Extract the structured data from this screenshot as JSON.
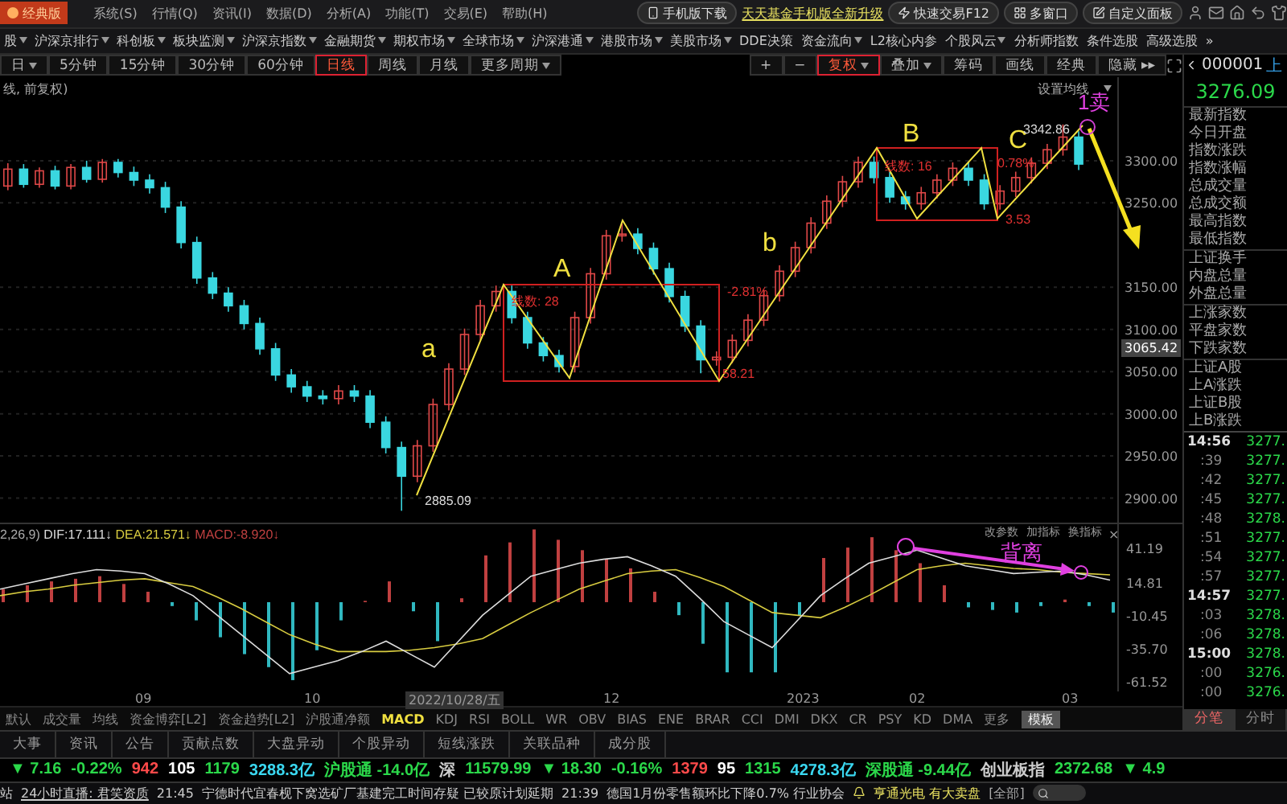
{
  "title_bar": {
    "logo": "经典版",
    "menus": [
      "系统(S)",
      "行情(Q)",
      "资讯(I)",
      "数据(D)",
      "分析(A)",
      "功能(T)",
      "交易(E)",
      "帮助(H)"
    ],
    "download": "手机版下载",
    "promo": "天天基金手机版全新升级",
    "buttons": [
      "快速交易F12",
      "多窗口",
      "自定义面板"
    ]
  },
  "nav": {
    "items": [
      {
        "label": "股",
        "dropdown": true
      },
      {
        "label": "沪深京排行",
        "dropdown": true
      },
      {
        "label": "科创板",
        "dropdown": true
      },
      {
        "label": "板块监测",
        "dropdown": true
      },
      {
        "label": "沪深京指数",
        "dropdown": true
      },
      {
        "label": "金融期货",
        "dropdown": true
      },
      {
        "label": "期权市场",
        "dropdown": true
      },
      {
        "label": "全球市场",
        "dropdown": true
      },
      {
        "label": "沪深港通",
        "dropdown": true
      },
      {
        "label": "港股市场",
        "dropdown": true
      },
      {
        "label": "美股市场",
        "dropdown": true
      },
      {
        "label": "DDE决策",
        "dropdown": false
      },
      {
        "label": "资金流向",
        "dropdown": true
      },
      {
        "label": "L2核心内参",
        "dropdown": false
      },
      {
        "label": "个股风云",
        "dropdown": true
      },
      {
        "label": "分析师指数",
        "dropdown": false
      },
      {
        "label": "条件选股",
        "dropdown": false
      },
      {
        "label": "高级选股",
        "dropdown": false
      }
    ],
    "more": "»"
  },
  "period_bar": {
    "periods": [
      {
        "label": "日",
        "dropdown": true,
        "selected": false
      },
      {
        "label": "5分钟",
        "dropdown": false,
        "selected": false
      },
      {
        "label": "15分钟",
        "dropdown": false,
        "selected": false
      },
      {
        "label": "30分钟",
        "dropdown": false,
        "selected": false
      },
      {
        "label": "60分钟",
        "dropdown": false,
        "selected": false
      },
      {
        "label": "日线",
        "dropdown": false,
        "selected": true
      },
      {
        "label": "周线",
        "dropdown": false,
        "selected": false
      },
      {
        "label": "月线",
        "dropdown": false,
        "selected": false
      },
      {
        "label": "更多周期",
        "dropdown": true,
        "selected": false
      }
    ],
    "tools": [
      {
        "label": "+",
        "dropdown": false,
        "selected": false
      },
      {
        "label": "−",
        "dropdown": false,
        "selected": false
      },
      {
        "label": "复权",
        "dropdown": true,
        "selected": true
      },
      {
        "label": "叠加",
        "dropdown": true,
        "selected": false
      },
      {
        "label": "筹码",
        "dropdown": false,
        "selected": false
      },
      {
        "label": "画线",
        "dropdown": false,
        "selected": false
      },
      {
        "label": "经典",
        "dropdown": false,
        "selected": false
      },
      {
        "label": "隐藏 ▸▸",
        "dropdown": false,
        "selected": false
      }
    ]
  },
  "chart": {
    "caption": "线, 前复权)",
    "ma_setting": "设置均线",
    "current_price": "3065.42",
    "annotations": [
      {
        "kind": "wave",
        "text": "a"
      },
      {
        "kind": "wave",
        "text": "A"
      },
      {
        "kind": "wave",
        "text": "b"
      },
      {
        "kind": "wave",
        "text": "B"
      },
      {
        "kind": "wave",
        "text": "C"
      },
      {
        "kind": "signal",
        "text": "1卖"
      },
      {
        "kind": "price",
        "text": "2885.09"
      },
      {
        "kind": "price",
        "text": "3342.86"
      },
      {
        "kind": "range",
        "text": "-2.81%"
      },
      {
        "kind": "range",
        "text": "0.78%"
      },
      {
        "kind": "range",
        "text": "58.21"
      },
      {
        "kind": "range",
        "text": "3.53"
      },
      {
        "kind": "range",
        "text": "线数: 28"
      },
      {
        "kind": "range",
        "text": "线数: 16"
      }
    ],
    "chart_data": {
      "type": "candlestick",
      "ylim": [
        2871,
        3399
      ],
      "yticks": [
        {
          "value": 3300,
          "label": "3300.00"
        },
        {
          "value": 3250,
          "label": "3250.00"
        },
        {
          "value": 3150,
          "label": "3150.00"
        },
        {
          "value": 3100,
          "label": "3100.00"
        },
        {
          "value": 3050,
          "label": "3050.00"
        },
        {
          "value": 3000,
          "label": "3000.00"
        },
        {
          "value": 2950,
          "label": "2950.00"
        },
        {
          "value": 2900,
          "label": "2900.00"
        }
      ],
      "grid": true,
      "ohlc": [
        [
          3270,
          3297,
          3265,
          3290
        ],
        [
          3290,
          3296,
          3268,
          3272
        ],
        [
          3272,
          3292,
          3268,
          3288
        ],
        [
          3288,
          3294,
          3266,
          3270
        ],
        [
          3270,
          3296,
          3266,
          3292
        ],
        [
          3292,
          3300,
          3274,
          3278
        ],
        [
          3278,
          3302,
          3274,
          3298
        ],
        [
          3298,
          3302,
          3280,
          3286
        ],
        [
          3286,
          3293,
          3270,
          3277
        ],
        [
          3277,
          3284,
          3261,
          3268
        ],
        [
          3268,
          3275,
          3238,
          3245
        ],
        [
          3245,
          3252,
          3196,
          3203
        ],
        [
          3203,
          3210,
          3154,
          3161
        ],
        [
          3161,
          3168,
          3136,
          3143
        ],
        [
          3143,
          3150,
          3121,
          3128
        ],
        [
          3128,
          3135,
          3100,
          3107
        ],
        [
          3107,
          3114,
          3070,
          3077
        ],
        [
          3077,
          3084,
          3039,
          3046
        ],
        [
          3046,
          3053,
          3025,
          3032
        ],
        [
          3032,
          3039,
          3014,
          3021
        ],
        [
          3021,
          3028,
          3011,
          3018
        ],
        [
          3018,
          3034,
          3011,
          3027
        ],
        [
          3027,
          3034,
          3014,
          3021
        ],
        [
          3021,
          3028,
          2983,
          2990
        ],
        [
          2990,
          2997,
          2953,
          2960
        ],
        [
          2960,
          2967,
          2885,
          2926
        ],
        [
          2926,
          2969,
          2919,
          2962
        ],
        [
          2962,
          3018,
          2955,
          3011
        ],
        [
          3011,
          3060,
          3004,
          3053
        ],
        [
          3053,
          3101,
          3046,
          3094
        ],
        [
          3094,
          3135,
          3087,
          3128
        ],
        [
          3128,
          3152,
          3121,
          3145
        ],
        [
          3145,
          3152,
          3107,
          3114
        ],
        [
          3114,
          3121,
          3077,
          3084
        ],
        [
          3084,
          3091,
          3062,
          3069
        ],
        [
          3069,
          3076,
          3049,
          3056
        ],
        [
          3056,
          3121,
          3049,
          3114
        ],
        [
          3114,
          3173,
          3107,
          3166
        ],
        [
          3166,
          3218,
          3159,
          3211
        ],
        [
          3211,
          3226,
          3204,
          3213
        ],
        [
          3213,
          3220,
          3189,
          3196
        ],
        [
          3196,
          3203,
          3165,
          3172
        ],
        [
          3172,
          3179,
          3132,
          3139
        ],
        [
          3139,
          3146,
          3097,
          3104
        ],
        [
          3104,
          3111,
          3048,
          3064
        ],
        [
          3064,
          3074,
          3057,
          3067
        ],
        [
          3067,
          3094,
          3060,
          3087
        ],
        [
          3087,
          3118,
          3080,
          3111
        ],
        [
          3111,
          3147,
          3104,
          3140
        ],
        [
          3140,
          3176,
          3133,
          3169
        ],
        [
          3169,
          3204,
          3162,
          3197
        ],
        [
          3197,
          3233,
          3190,
          3226
        ],
        [
          3226,
          3259,
          3219,
          3252
        ],
        [
          3252,
          3282,
          3245,
          3275
        ],
        [
          3275,
          3305,
          3268,
          3298
        ],
        [
          3298,
          3305,
          3273,
          3280
        ],
        [
          3280,
          3287,
          3250,
          3257
        ],
        [
          3257,
          3264,
          3242,
          3249
        ],
        [
          3249,
          3269,
          3242,
          3262
        ],
        [
          3262,
          3284,
          3255,
          3277
        ],
        [
          3277,
          3298,
          3270,
          3291
        ],
        [
          3291,
          3298,
          3270,
          3277
        ],
        [
          3277,
          3284,
          3242,
          3249
        ],
        [
          3249,
          3271,
          3242,
          3264
        ],
        [
          3264,
          3287,
          3257,
          3280
        ],
        [
          3280,
          3304,
          3273,
          3297
        ],
        [
          3297,
          3320,
          3290,
          3313
        ],
        [
          3313,
          3343,
          3306,
          3328
        ],
        [
          3328,
          3335,
          3289,
          3296
        ],
        null,
        null
      ]
    }
  },
  "macd": {
    "params": "2,26,9)",
    "readings": [
      ":17.111↓",
      ":21.571↓",
      ":-8.920↓"
    ],
    "actions": [
      "改参数",
      "加指标",
      "换指标"
    ],
    "close": "×",
    "divergence": "背离",
    "chart_data": {
      "type": "line",
      "ylim": [
        -68.71,
        61.24
      ],
      "yticks": [
        {
          "value": 41.19,
          "label": "41.19"
        },
        {
          "value": 14.81,
          "label": "14.81"
        },
        {
          "value": -10.45,
          "label": "-10.45"
        },
        {
          "value": -35.7,
          "label": "-35.70"
        },
        {
          "value": -61.52,
          "label": "-61.52"
        }
      ],
      "series": [
        {
          "name": "DIF",
          "color": "#dddddd",
          "values": [
            10,
            14,
            18,
            22,
            25,
            24,
            22,
            14,
            5,
            -10,
            -25,
            -40,
            -55,
            -50,
            -45,
            -38,
            -30,
            -40,
            -50,
            -30,
            -10,
            5,
            20,
            25,
            30,
            33,
            35,
            28,
            20,
            3,
            -15,
            -25,
            -35,
            -15,
            5,
            18,
            30,
            35,
            40,
            34,
            28,
            25,
            22,
            23,
            24,
            21,
            17
          ]
        },
        {
          "name": "DEA",
          "color": "#d8cc40",
          "values": [
            5,
            8,
            10,
            13,
            15,
            17,
            18,
            15,
            12,
            4,
            -5,
            -15,
            -25,
            -32,
            -38,
            -38,
            -38,
            -37,
            -35,
            -32,
            -28,
            -18,
            -8,
            1,
            10,
            16,
            22,
            24,
            25,
            19,
            12,
            2,
            -8,
            -10,
            -12,
            -4,
            5,
            15,
            25,
            28,
            30,
            28,
            26,
            25,
            23,
            22,
            21
          ]
        },
        {
          "name": "MACD",
          "type": "bar",
          "color": "#c04040",
          "values": [
            10,
            13,
            16,
            18,
            20,
            14,
            8,
            null,
            null,
            null,
            null,
            null,
            null,
            null,
            null,
            1,
            16,
            null,
            null,
            3,
            36,
            46,
            56,
            48,
            40,
            33,
            26,
            8,
            null,
            null,
            null,
            null,
            null,
            null,
            34,
            42,
            50,
            40,
            30,
            13,
            null,
            null,
            null,
            null,
            2,
            null,
            null
          ]
        },
        {
          "type": "bar",
          "color": "#30b8c0",
          "values": [
            null,
            null,
            null,
            null,
            null,
            null,
            null,
            -3,
            -14,
            -27,
            -40,
            -50,
            -60,
            -37,
            -14,
            null,
            null,
            -7,
            -30,
            null,
            null,
            null,
            null,
            null,
            null,
            null,
            null,
            null,
            -10,
            -32,
            -54,
            -54,
            -54,
            -10,
            null,
            null,
            null,
            null,
            null,
            null,
            -4,
            -6,
            -8,
            -3,
            null,
            -3,
            -8
          ]
        }
      ]
    }
  },
  "dates": [
    {
      "label": "09",
      "highlighted": false
    },
    {
      "label": "10",
      "highlighted": false
    },
    {
      "label": "2022/10/28/五",
      "highlighted": true
    },
    {
      "label": "12",
      "highlighted": false
    },
    {
      "label": "2023",
      "highlighted": false
    },
    {
      "label": "02",
      "highlighted": false
    },
    {
      "label": "03",
      "highlighted": false
    }
  ],
  "indicator_tabs": [
    {
      "label": "默认",
      "selected": false
    },
    {
      "label": "成交量",
      "selected": false
    },
    {
      "label": "均线",
      "selected": false
    },
    {
      "label": "资金博弈[L2]",
      "selected": false
    },
    {
      "label": "资金趋势[L2]",
      "selected": false
    },
    {
      "label": "沪股通净额",
      "selected": false
    },
    {
      "label": "MACD",
      "selected": true
    },
    {
      "label": "KDJ",
      "selected": false
    },
    {
      "label": "RSI",
      "selected": false
    },
    {
      "label": "BOLL",
      "selected": false
    },
    {
      "label": "WR",
      "selected": false
    },
    {
      "label": "OBV",
      "selected": false
    },
    {
      "label": "BIAS",
      "selected": false
    },
    {
      "label": "ENE",
      "selected": false
    },
    {
      "label": "BRAR",
      "selected": false
    },
    {
      "label": "CCI",
      "selected": false
    },
    {
      "label": "DMI",
      "selected": false
    },
    {
      "label": "DKX",
      "selected": false
    },
    {
      "label": "CR",
      "selected": false
    },
    {
      "label": "PSY",
      "selected": false
    },
    {
      "label": "KD",
      "selected": false
    },
    {
      "label": "DMA",
      "selected": false
    },
    {
      "label": "更多",
      "selected": false
    }
  ],
  "template": "模板",
  "info_tabs": [
    "大事",
    "资讯",
    "公告",
    "贡献点数",
    "大盘异动",
    "个股异动",
    "短线涨跌",
    "关联品种",
    "成分股"
  ],
  "ticker": [
    {
      "text": "▼ 7.16",
      "color": "#2bd84a"
    },
    {
      "text": "-0.22%",
      "color": "#2bd84a"
    },
    {
      "text": "942",
      "color": "#ff4a4a"
    },
    {
      "text": "105",
      "color": "#ffffff"
    },
    {
      "text": "1179",
      "color": "#2bd84a"
    },
    {
      "text": "3288.3亿",
      "color": "#3ad7f0"
    },
    {
      "text": "沪股通 -14.0亿",
      "color": "#2bd84a"
    },
    {
      "text": "深",
      "color": "#cccccc"
    },
    {
      "text": "11579.99",
      "color": "#2bd84a"
    },
    {
      "text": "▼ 18.30",
      "color": "#2bd84a"
    },
    {
      "text": "-0.16%",
      "color": "#2bd84a"
    },
    {
      "text": "1379",
      "color": "#ff4a4a"
    },
    {
      "text": "95",
      "color": "#ffffff"
    },
    {
      "text": "1315",
      "color": "#2bd84a"
    },
    {
      "text": "4278.3亿",
      "color": "#3ad7f0"
    },
    {
      "text": "深股通 -9.44亿",
      "color": "#2bd84a"
    },
    {
      "text": "创业板指",
      "color": "#cccccc"
    },
    {
      "text": "2372.68",
      "color": "#2bd84a"
    },
    {
      "text": "▼ 4.9",
      "color": "#2bd84a"
    }
  ],
  "news": {
    "lead": "站",
    "live": "24小时直播: 君笑资质",
    "items": [
      {
        "time": "21:45",
        "text": "宁德时代宜春枧下窝选矿厂基建完工时间存疑 已较原计划延期"
      },
      {
        "time": "21:39",
        "text": "德国1月份零售额环比下降0.7% 行业协会"
      }
    ],
    "alert": "亨通光电 有大卖盘",
    "all": "[全部]"
  },
  "right_panel": {
    "code": "000001",
    "market": "上",
    "price": "3276.09",
    "groups": [
      [
        "最新指数",
        "今日开盘",
        "指数涨跌",
        "指数涨幅",
        "总成交量",
        "总成交额",
        "最高指数",
        "最低指数"
      ],
      [
        "上证换手",
        "内盘总量",
        "外盘总量"
      ],
      [
        "上涨家数",
        "平盘家数",
        "下跌家数"
      ],
      [
        "上证A股",
        "上A涨跌",
        "上证B股",
        "上B涨跌"
      ]
    ],
    "ticks": [
      {
        "kind": "minute",
        "time": "14:56",
        "value": "3277."
      },
      {
        "kind": "second",
        "time": ":39",
        "value": "3277."
      },
      {
        "kind": "second",
        "time": ":42",
        "value": "3277."
      },
      {
        "kind": "second",
        "time": ":45",
        "value": "3277."
      },
      {
        "kind": "second",
        "time": ":48",
        "value": "3278."
      },
      {
        "kind": "second",
        "time": ":51",
        "value": "3277."
      },
      {
        "kind": "second",
        "time": ":54",
        "value": "3277."
      },
      {
        "kind": "second",
        "time": ":57",
        "value": "3277."
      },
      {
        "kind": "minute",
        "time": "14:57",
        "value": "3277."
      },
      {
        "kind": "second",
        "time": ":03",
        "value": "3278."
      },
      {
        "kind": "second",
        "time": ":06",
        "value": "3278."
      },
      {
        "kind": "minute",
        "time": "15:00",
        "value": "3278."
      },
      {
        "kind": "second",
        "time": ":00",
        "value": "3276."
      },
      {
        "kind": "second",
        "time": ":00",
        "value": "3276."
      }
    ],
    "tabs": [
      {
        "label": "分笔",
        "selected": true
      },
      {
        "label": "分时",
        "selected": false
      }
    ]
  }
}
